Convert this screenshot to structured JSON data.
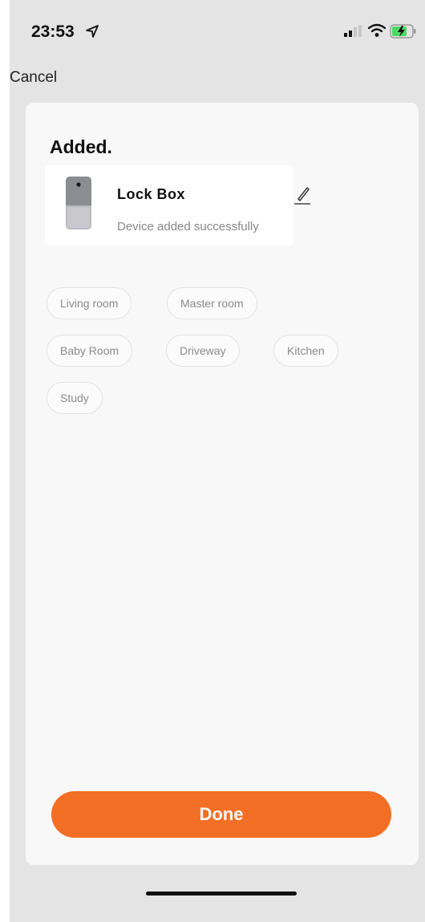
{
  "status_bar": {
    "time": "23:53",
    "location_icon": "location-arrow-icon",
    "signal_icon": "cellular-signal-icon",
    "wifi_icon": "wifi-icon",
    "battery_icon": "battery-charging-icon",
    "battery_color": "#4cd964"
  },
  "nav": {
    "cancel_label": "Cancel"
  },
  "result": {
    "title": "Added."
  },
  "device": {
    "name": "Lock Box",
    "status": "Device added successfully",
    "image_icon": "lock-box-device-icon",
    "edit_icon": "pencil-icon"
  },
  "rooms": [
    {
      "label": "Living room"
    },
    {
      "label": "Master room"
    },
    {
      "label": "Baby Room"
    },
    {
      "label": "Driveway"
    },
    {
      "label": "Kitchen"
    },
    {
      "label": "Study"
    }
  ],
  "actions": {
    "done_label": "Done"
  },
  "theme": {
    "accent": "#f36f25"
  }
}
